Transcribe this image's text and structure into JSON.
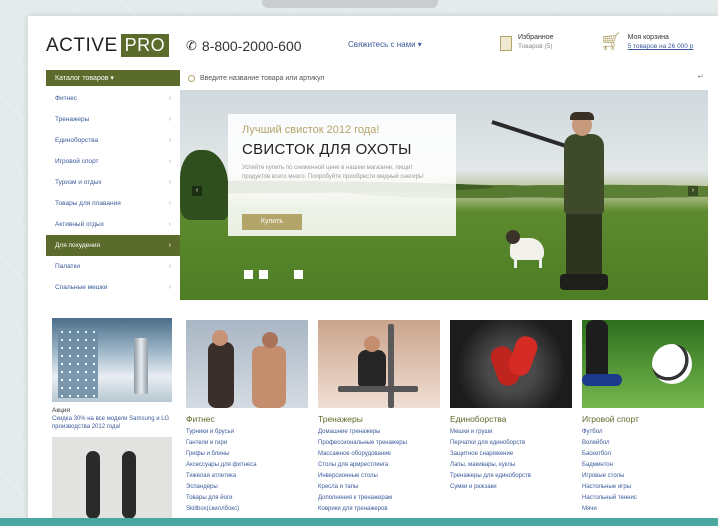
{
  "header": {
    "logo_text": "ACTIVE",
    "logo_badge": "PRO",
    "phone": "8-800-2000-600",
    "callback_label": "Свяжитесь с нами ▾",
    "favorites_title": "Избранное",
    "favorites_sub": "Товаров (5)",
    "cart_title": "Моя корзина",
    "cart_sub": "5 товаров на 26 000 р"
  },
  "catalog_button": "Каталог товаров ▾",
  "search": {
    "placeholder": "Введите название товара или артикул"
  },
  "sidebar": {
    "items": [
      {
        "label": "Фитнес",
        "active": false
      },
      {
        "label": "Тренажеры",
        "active": false
      },
      {
        "label": "Единоборства",
        "active": false
      },
      {
        "label": "Игровой спорт",
        "active": false
      },
      {
        "label": "Туризм и отдых",
        "active": false
      },
      {
        "label": "Товары для плавания",
        "active": false
      },
      {
        "label": "Активный отдых",
        "active": false
      },
      {
        "label": "Для похудения",
        "active": true
      },
      {
        "label": "Палатки",
        "active": false
      },
      {
        "label": "Спальные мешки",
        "active": false
      }
    ]
  },
  "hero": {
    "kicker": "Лучший свисток 2012 года!",
    "title": "СВИСТОК ДЛЯ ОХОТЫ",
    "text": "Успейте купить по сниженной цене в нашем магазине, пищит продуктов всего много. Попробуйте приобрести медный снегирь!",
    "button": "Купить",
    "arrow_left": "‹",
    "arrow_right": "›"
  },
  "side_promo": {
    "label": "Акция",
    "description": "Скидка 30% на все модели Samsung и LG производства 2012 года!"
  },
  "categories": [
    {
      "title": "Фитнес",
      "links": [
        "Турники и брусья",
        "Гантели и гири",
        "Грифы и блины",
        "Аксессуары для фитнеса",
        "Тяжелая атлетика",
        "Эспандеры",
        "Товары для йоги",
        "Skillbox(скиллбокс)"
      ]
    },
    {
      "title": "Тренажеры",
      "links": [
        "Домашние тренажеры",
        "Профессиональные тренажеры",
        "Массажное оборудование",
        "Столы для армрестлинга",
        "Инверсионные столы",
        "Кресла и тапы",
        "Дополнения к тренажерам",
        "Коврики для тренажеров"
      ]
    },
    {
      "title": "Единоборства",
      "links": [
        "Мешки и груши",
        "Перчатки для единоборств",
        "Защитное снаряжение",
        "Лапы, макивары, куклы",
        "Тренажеры для единоборств",
        "Сумки и рюкзаки"
      ]
    },
    {
      "title": "Игровой спорт",
      "links": [
        "Футбол",
        "Волейбол",
        "Баскетбол",
        "Бадминтон",
        "Игровые столы",
        "Настольные игры",
        "Настольный теннис",
        "Мячи"
      ]
    }
  ]
}
